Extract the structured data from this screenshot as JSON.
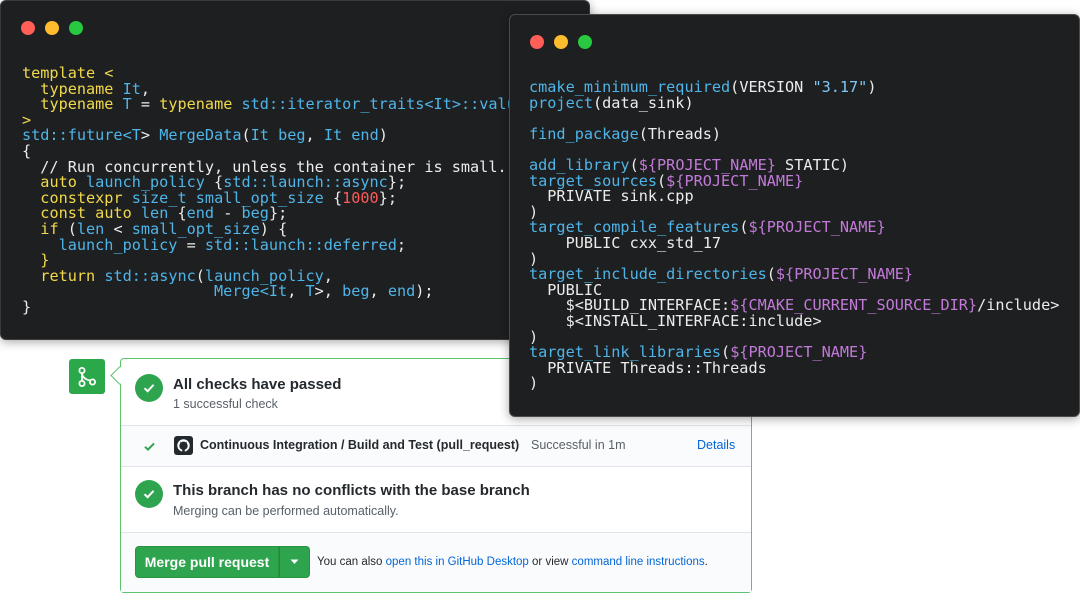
{
  "cpp_window": {
    "lines": [
      [
        {
          "t": "template <",
          "c": "kw"
        }
      ],
      [
        {
          "t": "  "
        },
        {
          "t": "typename",
          "c": "kw"
        },
        {
          "t": " "
        },
        {
          "t": "It",
          "c": "ty"
        },
        {
          "t": ","
        }
      ],
      [
        {
          "t": "  "
        },
        {
          "t": "typename",
          "c": "kw"
        },
        {
          "t": " "
        },
        {
          "t": "T",
          "c": "ty"
        },
        {
          "t": " = "
        },
        {
          "t": "typename",
          "c": "kw"
        },
        {
          "t": " "
        },
        {
          "t": "std::iterator_traits<",
          "c": "ty"
        },
        {
          "t": "It",
          "c": "ty"
        },
        {
          "t": ">::valu",
          "c": "ty"
        }
      ],
      [
        {
          "t": ">",
          "c": "kw"
        }
      ],
      [
        {
          "t": "std::future<",
          "c": "ty"
        },
        {
          "t": "T",
          "c": "ty"
        },
        {
          "t": "> "
        },
        {
          "t": "MergeData",
          "c": "fn"
        },
        {
          "t": "("
        },
        {
          "t": "It",
          "c": "ty"
        },
        {
          "t": " "
        },
        {
          "t": "beg",
          "c": "ty"
        },
        {
          "t": ", "
        },
        {
          "t": "It",
          "c": "ty"
        },
        {
          "t": " "
        },
        {
          "t": "end",
          "c": "ty"
        },
        {
          "t": ")"
        }
      ],
      [
        {
          "t": "{"
        }
      ],
      [
        {
          "t": "  // Run concurrently, unless the container is small.",
          "c": "cm"
        }
      ],
      [
        {
          "t": "  "
        },
        {
          "t": "auto",
          "c": "kw"
        },
        {
          "t": " "
        },
        {
          "t": "launch_policy",
          "c": "ty"
        },
        {
          "t": " {"
        },
        {
          "t": "std::launch::async",
          "c": "ty"
        },
        {
          "t": "};"
        }
      ],
      [
        {
          "t": "  "
        },
        {
          "t": "constexpr",
          "c": "kw"
        },
        {
          "t": " "
        },
        {
          "t": "size_t",
          "c": "ty"
        },
        {
          "t": " "
        },
        {
          "t": "small_opt_size",
          "c": "ty"
        },
        {
          "t": " {"
        },
        {
          "t": "1000",
          "c": "num"
        },
        {
          "t": "};"
        }
      ],
      [
        {
          "t": "  "
        },
        {
          "t": "const",
          "c": "kw"
        },
        {
          "t": " "
        },
        {
          "t": "auto",
          "c": "kw"
        },
        {
          "t": " "
        },
        {
          "t": "len",
          "c": "ty"
        },
        {
          "t": " {"
        },
        {
          "t": "end",
          "c": "ty"
        },
        {
          "t": " - "
        },
        {
          "t": "beg",
          "c": "ty"
        },
        {
          "t": "};"
        }
      ],
      [
        {
          "t": "  "
        },
        {
          "t": "if",
          "c": "kw"
        },
        {
          "t": " ("
        },
        {
          "t": "len",
          "c": "ty"
        },
        {
          "t": " < "
        },
        {
          "t": "small_opt_size",
          "c": "ty"
        },
        {
          "t": ") {"
        }
      ],
      [
        {
          "t": "    "
        },
        {
          "t": "launch_policy",
          "c": "ty"
        },
        {
          "t": " = "
        },
        {
          "t": "std::launch::deferred",
          "c": "ty"
        },
        {
          "t": ";"
        }
      ],
      [
        {
          "t": "  "
        },
        {
          "t": "}",
          "c": "kw"
        }
      ],
      [
        {
          "t": "  "
        },
        {
          "t": "return",
          "c": "kw"
        },
        {
          "t": " "
        },
        {
          "t": "std::async",
          "c": "ty"
        },
        {
          "t": "("
        },
        {
          "t": "launch_policy",
          "c": "ty"
        },
        {
          "t": ","
        }
      ],
      [
        {
          "t": "                     "
        },
        {
          "t": "Merge<",
          "c": "ty"
        },
        {
          "t": "It",
          "c": "ty"
        },
        {
          "t": ", "
        },
        {
          "t": "T",
          "c": "ty"
        },
        {
          "t": ">, "
        },
        {
          "t": "beg",
          "c": "ty"
        },
        {
          "t": ", "
        },
        {
          "t": "end",
          "c": "ty"
        },
        {
          "t": ");"
        }
      ],
      [
        {
          "t": "}"
        }
      ]
    ]
  },
  "cmake_window": {
    "lines": [
      [
        {
          "t": "cmake_minimum_required",
          "c": "fn"
        },
        {
          "t": "(VERSION "
        },
        {
          "t": "\"3.17\"",
          "c": "str"
        },
        {
          "t": ")"
        }
      ],
      [
        {
          "t": "project",
          "c": "fn"
        },
        {
          "t": "(data_sink)"
        }
      ],
      [],
      [
        {
          "t": "find_package",
          "c": "fn"
        },
        {
          "t": "(Threads)"
        }
      ],
      [],
      [
        {
          "t": "add_library",
          "c": "fn"
        },
        {
          "t": "("
        },
        {
          "t": "${PROJECT_NAME}",
          "c": "var"
        },
        {
          "t": " STATIC)"
        }
      ],
      [
        {
          "t": "target_sources",
          "c": "fn"
        },
        {
          "t": "("
        },
        {
          "t": "${PROJECT_NAME}",
          "c": "var"
        }
      ],
      [
        {
          "t": "  PRIVATE sink.cpp"
        }
      ],
      [
        {
          "t": ")"
        }
      ],
      [
        {
          "t": "target_compile_features",
          "c": "fn"
        },
        {
          "t": "("
        },
        {
          "t": "${PROJECT_NAME}",
          "c": "var"
        }
      ],
      [
        {
          "t": "    PUBLIC cxx_std_17"
        }
      ],
      [
        {
          "t": ")"
        }
      ],
      [
        {
          "t": "target_include_directories",
          "c": "fn"
        },
        {
          "t": "("
        },
        {
          "t": "${PROJECT_NAME}",
          "c": "var"
        }
      ],
      [
        {
          "t": "  PUBLIC"
        }
      ],
      [
        {
          "t": "    $<BUILD_INTERFACE:"
        },
        {
          "t": "${CMAKE_CURRENT_SOURCE_DIR}",
          "c": "var"
        },
        {
          "t": "/include>"
        }
      ],
      [
        {
          "t": "    $<INSTALL_INTERFACE:include>"
        }
      ],
      [
        {
          "t": ")"
        }
      ],
      [
        {
          "t": "target_link_libraries",
          "c": "fn"
        },
        {
          "t": "("
        },
        {
          "t": "${PROJECT_NAME}",
          "c": "var"
        }
      ],
      [
        {
          "t": "  PRIVATE Threads::Threads"
        }
      ],
      [
        {
          "t": ")"
        }
      ]
    ]
  },
  "pr": {
    "checks_title": "All checks have passed",
    "checks_subtitle": "1 successful check",
    "ci_name": "Continuous Integration / Build and Test (pull_request)",
    "ci_status": "Successful in 1m",
    "details_label": "Details",
    "conflicts_title": "This branch has no conflicts with the base branch",
    "conflicts_subtitle": "Merging can be performed automatically.",
    "merge_button_label": "Merge pull request",
    "alt_prefix": "You can also ",
    "alt_desktop_link": "open this in GitHub Desktop",
    "alt_middle": " or view ",
    "alt_cli_link": "command line instructions",
    "alt_suffix": "."
  },
  "colors": {
    "success": "#2ea44f",
    "link": "#0366d6",
    "code_bg": "#1e1f21"
  },
  "icons": [
    "git-branch-icon",
    "check-circle-icon",
    "check-icon",
    "github-icon",
    "caret-down-icon"
  ]
}
